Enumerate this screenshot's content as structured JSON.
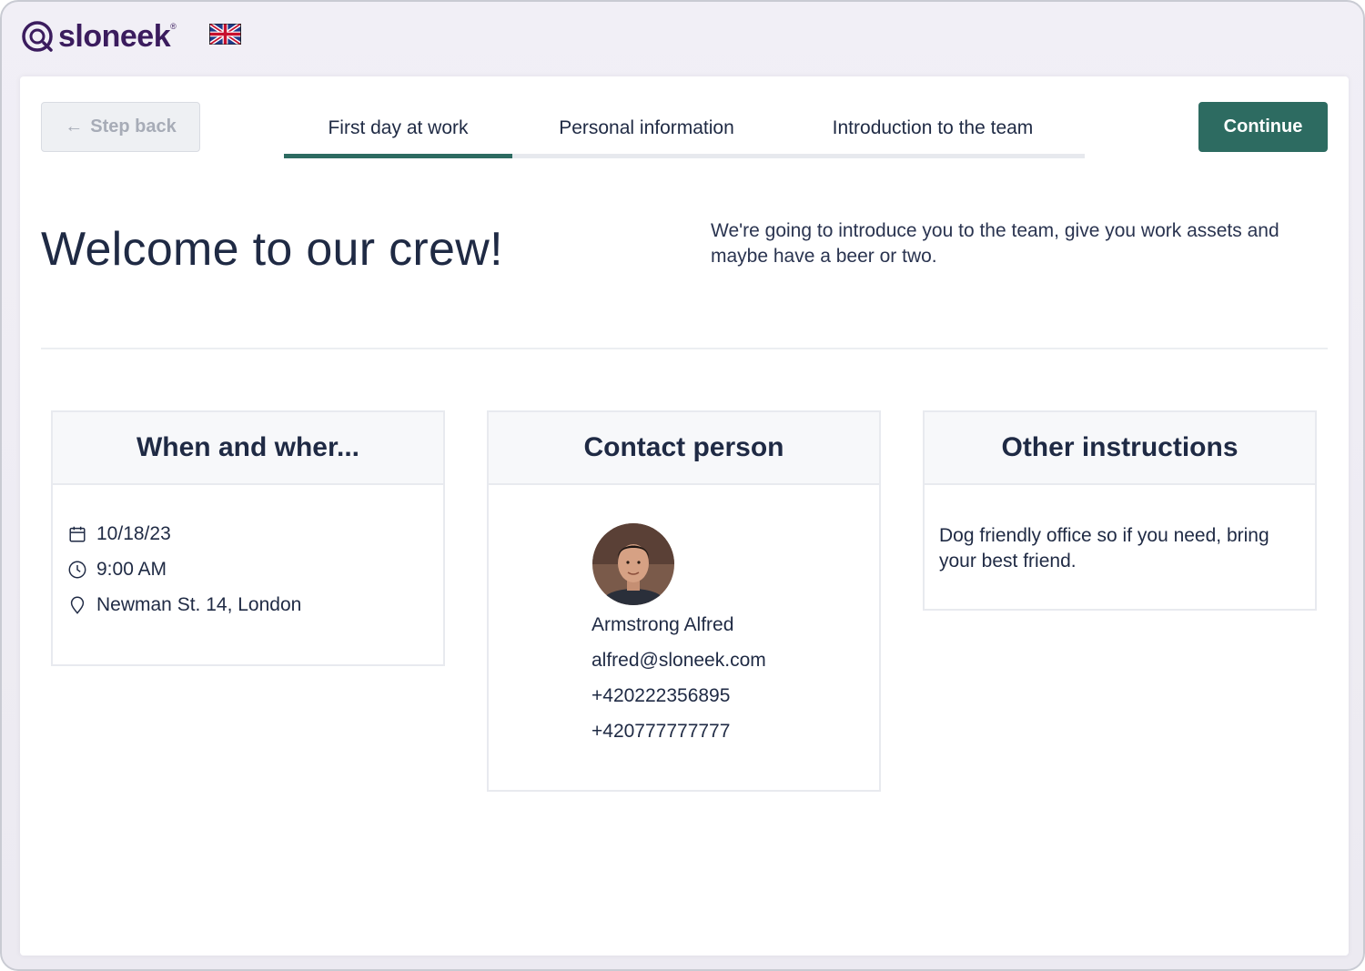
{
  "brand": {
    "name": "sloneek",
    "reg": "®"
  },
  "language": {
    "flag": "uk-flag"
  },
  "nav": {
    "step_back": "Step back",
    "tabs": [
      {
        "label": "First day at work",
        "active": true
      },
      {
        "label": "Personal information",
        "active": false
      },
      {
        "label": "Introduction to the team",
        "active": false
      }
    ],
    "continue": "Continue"
  },
  "header": {
    "title": "Welcome to our crew!",
    "intro": "We're going to introduce you to the team, give you work assets and maybe have a beer or two."
  },
  "when_where": {
    "title": "When and wher...",
    "date": "10/18/23",
    "time": "9:00 AM",
    "location": "Newman St. 14, London"
  },
  "contact": {
    "title": "Contact person",
    "name": "Armstrong Alfred",
    "email": "alfred@sloneek.com",
    "phone1": "+420222356895",
    "phone2": "+420777777777"
  },
  "other": {
    "title": "Other instructions",
    "text": "Dog friendly office so if you need, bring your best friend."
  },
  "colors": {
    "accent": "#2d6b61",
    "brand": "#3b1c5e",
    "text": "#1f2a44"
  }
}
